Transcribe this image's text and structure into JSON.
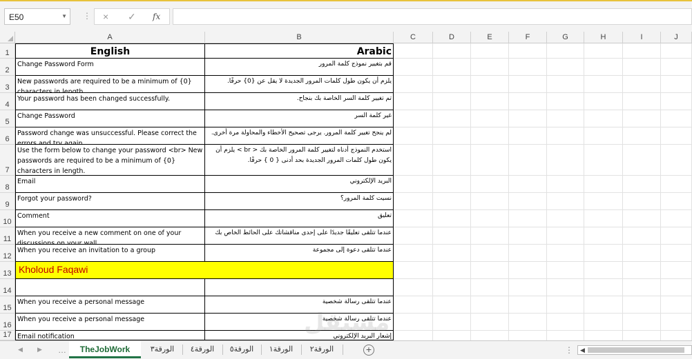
{
  "formula_bar": {
    "name_box": "E50",
    "cancel_icon": "×",
    "enter_icon": "✓",
    "fx_label": "fx",
    "formula": ""
  },
  "columns": [
    "A",
    "B",
    "C",
    "D",
    "E",
    "F",
    "G",
    "H",
    "I",
    "J"
  ],
  "rows": [
    {
      "num": "1",
      "en": "English",
      "ar": "Arabic",
      "header": true
    },
    {
      "num": "2",
      "en": "Change Password Form",
      "ar": "قم بتغيير نموذج كلمة المرور"
    },
    {
      "num": "3",
      "en": "New passwords are required to be a minimum of {0} characters in length.",
      "ar": "يلزم أن يكون طول كلمات المرور الجديدة لا يقل عن {0} حرفًا."
    },
    {
      "num": "4",
      "en": "Your password has been changed successfully.",
      "ar": "تم تغيير كلمة السر الخاصة بك بنجاح."
    },
    {
      "num": "5",
      "en": "Change Password",
      "ar": "غير كلمة السر"
    },
    {
      "num": "6",
      "en": "Password change was unsuccessful. Please correct the errors and try again.",
      "ar": "لم ينجح تغيير كلمة المرور. يرجى تصحيح الأخطاء والمحاولة مرة أخرى."
    },
    {
      "num": "7",
      "en": "Use the form below to change your password <br> New passwords are required to be a minimum of {0} characters in length.",
      "ar": "استخدم النموذج أدناه لتغيير كلمة المرور الخاصة بك < br > يلزم أن يكون طول كلمات المرور الجديدة بحد أدنى { 0 } حرفًا."
    },
    {
      "num": "8",
      "en": "Email",
      "ar": "البريد الإلكتروني"
    },
    {
      "num": "9",
      "en": "Forgot your password?",
      "ar": "نسيت كلمة المرور؟"
    },
    {
      "num": "10",
      "en": "Comment",
      "ar": "تعليق"
    },
    {
      "num": "11",
      "en": "When you receive a new comment on one of your discussions on your wall",
      "ar": "عندما تتلقى تعليقًا جديدًا على إحدى مناقشاتك على الحائط الخاص بك"
    },
    {
      "num": "12",
      "en": "When you receive an invitation to a group",
      "ar": "عندما تتلقى دعوة إلى مجموعة"
    },
    {
      "num": "13",
      "en": "Kholoud Faqawi",
      "ar": "",
      "banner": true
    },
    {
      "num": "14",
      "en": "",
      "ar": ""
    },
    {
      "num": "15",
      "en": "When you receive a personal message",
      "ar": "عندما تتلقى رسالة شخصية"
    },
    {
      "num": "16",
      "en": "When you receive a personal message",
      "ar": "عندما تتلقى رسالة شخصية"
    },
    {
      "num": "17",
      "en": "Email notification",
      "ar": "إشعار البريد الإلكتروني"
    }
  ],
  "sheets": {
    "active": "TheJobWork",
    "tabs": [
      "الورقة٣",
      "الورقة٤",
      "الورقة٥",
      "الورقة١",
      "الورقة٢"
    ]
  },
  "watermark": "مستقل",
  "colors": {
    "accent": "#217346",
    "banner_bg": "#ffff00",
    "banner_text": "#c00000"
  }
}
